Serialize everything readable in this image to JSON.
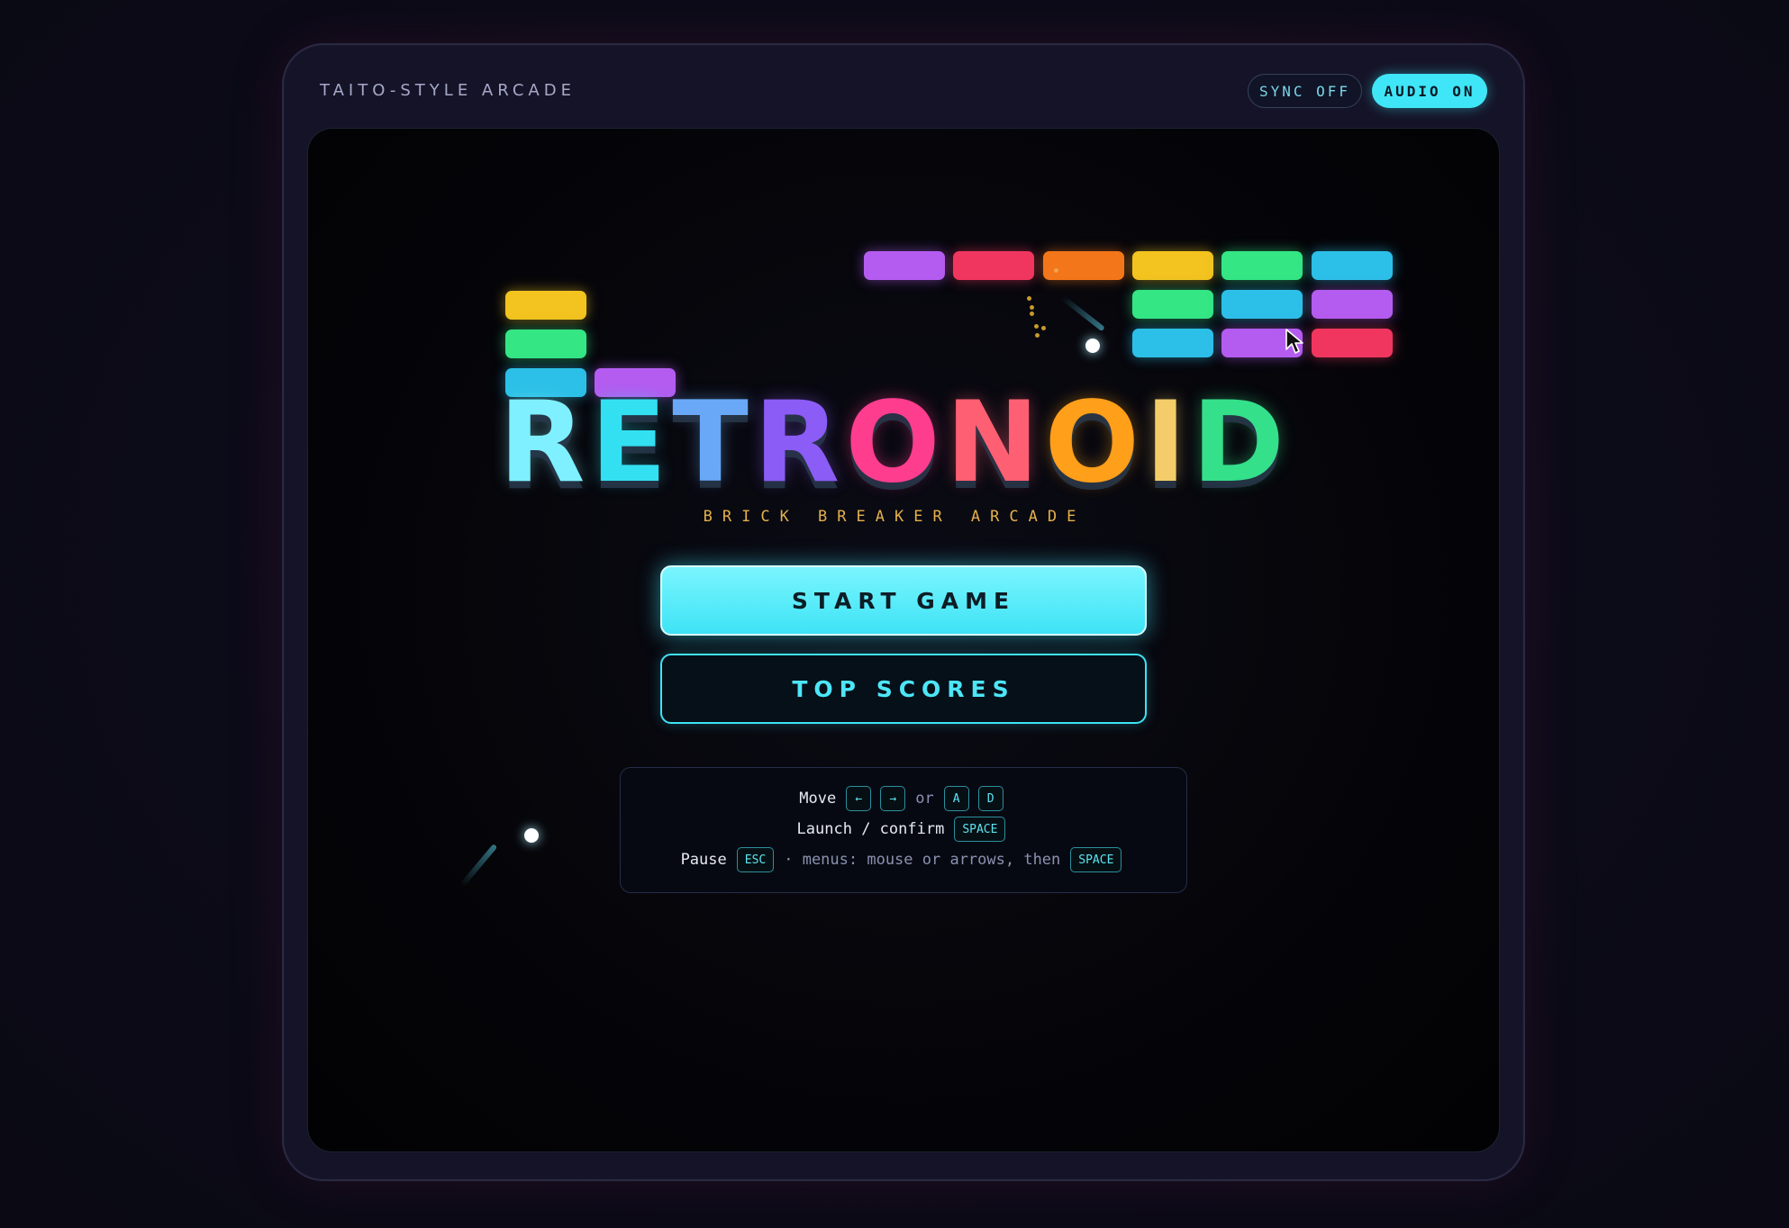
{
  "header": {
    "brand": "TAITO-STYLE ARCADE",
    "sync_label": "SYNC OFF",
    "audio_label": "AUDIO ON"
  },
  "title": {
    "letters": [
      "R",
      "E",
      "T",
      "R",
      "O",
      "N",
      "O",
      "I",
      "D"
    ],
    "letter_colors": [
      "#7ff0ff",
      "#33e0f2",
      "#69a8f6",
      "#8b5cf6",
      "#ff3d8f",
      "#ff5f72",
      "#ff9f1a",
      "#f4cd6a",
      "#34e08a"
    ],
    "tagline": "BRICK BREAKER ARCADE"
  },
  "menu": {
    "start_label": "START GAME",
    "scores_label": "TOP SCORES"
  },
  "help": {
    "move_label": "Move",
    "or_label": "or",
    "move_keys": [
      "←",
      "→"
    ],
    "alt_keys": [
      "A",
      "D"
    ],
    "launch_label": "Launch / confirm",
    "launch_key": "SPACE",
    "pause_label": "Pause",
    "pause_key": "ESC",
    "menus_hint": "· menus: mouse or arrows, then",
    "menus_key": "SPACE"
  },
  "colors": {
    "accent_cyan": "#3fe6f7",
    "tagline_gold": "#e4b04a",
    "purple": "#b45cf0",
    "red": "#f0365f",
    "orange": "#f3761a",
    "yellow": "#f3c31f",
    "green": "#34e684",
    "blue": "#2cc0e8"
  },
  "bricks_right": [
    [
      "purple",
      "red",
      "orange",
      "yellow",
      "green",
      "blue"
    ],
    [
      "",
      "",
      "",
      "green",
      "blue",
      "purple"
    ],
    [
      "",
      "",
      "",
      "blue",
      "purple",
      "red"
    ]
  ],
  "bricks_left": [
    [
      "yellow",
      ""
    ],
    [
      "green",
      ""
    ],
    [
      "blue",
      "purple"
    ]
  ],
  "icons": {
    "cursor": "mouse-pointer-icon",
    "ball": "ball-icon"
  }
}
